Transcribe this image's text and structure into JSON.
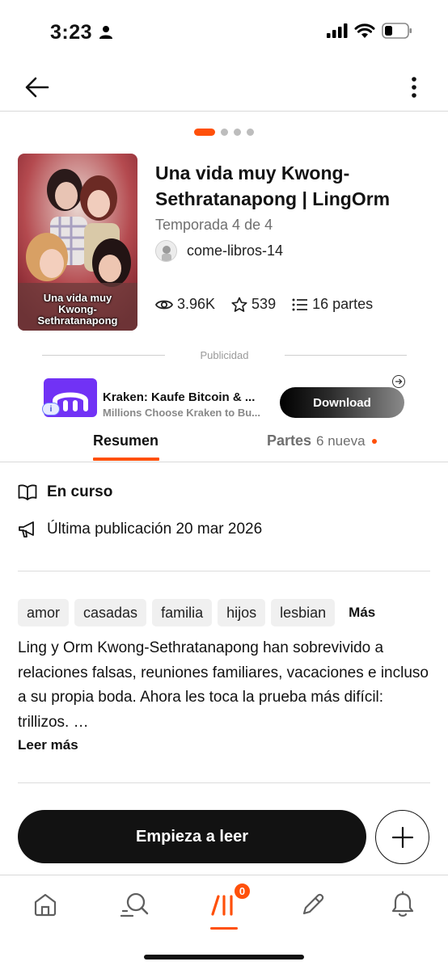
{
  "status_bar": {
    "time": "3:23",
    "icons": [
      "person-icon",
      "signal-icon",
      "wifi-icon",
      "battery-icon"
    ]
  },
  "top_nav": {
    "back_icon": "arrow-left-icon",
    "more_icon": "vertical-dots-icon"
  },
  "carousel": {
    "count": 4,
    "active_index": 0
  },
  "book": {
    "cover_text": "Una vida muy Kwong-Sethratanapong",
    "title": "Una vida muy Kwong-Sethratanapong | LingOrm",
    "season": "Temporada 4 de 4",
    "author": "come-libros-14",
    "stats": {
      "reads": "3.96K",
      "votes": "539",
      "parts": "16 partes"
    }
  },
  "ad": {
    "label": "Publicidad",
    "title": "Kraken: Kaufe Bitcoin & ...",
    "subtitle": "Millions Choose Kraken to Bu...",
    "cta": "Download",
    "info_badge": "i",
    "choices_icon": "adchoices-icon"
  },
  "tabs": {
    "summary": "Resumen",
    "parts": "Partes",
    "parts_new": "6 nueva"
  },
  "status": {
    "state": "En curso",
    "last_update": "Última publicación 20 mar 2026"
  },
  "tags": [
    "amor",
    "casadas",
    "familia",
    "hijos",
    "lesbian"
  ],
  "tags_more": "Más",
  "description": "Ling y Orm Kwong-Sethratanapong han sobrevivido a relaciones falsas, reuniones familiares, vacaciones e incluso a su propia boda. Ahora les toca la prueba más difícil: trillizos. …",
  "read_more": "Leer más",
  "cta": {
    "start": "Empieza a leer",
    "add_icon": "plus-icon"
  },
  "bottom_nav": {
    "items": [
      "home-icon",
      "search-icon",
      "library-icon",
      "write-icon",
      "notifications-icon"
    ],
    "library_badge": "0",
    "active": "library-icon"
  },
  "colors": {
    "accent": "#ff500a",
    "text": "#121212",
    "muted": "#6f6f6f"
  }
}
